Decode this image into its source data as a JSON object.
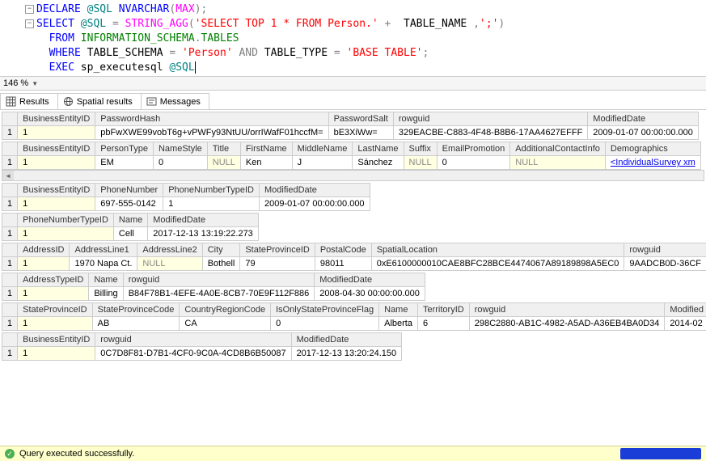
{
  "editor": {
    "lines": [
      {
        "collapse": true,
        "tokens": [
          {
            "cls": "kw-blue",
            "t": "DECLARE"
          },
          {
            "cls": "",
            "t": " "
          },
          {
            "cls": "kw-teal",
            "t": "@SQL"
          },
          {
            "cls": "",
            "t": " "
          },
          {
            "cls": "kw-blue",
            "t": "NVARCHAR"
          },
          {
            "cls": "kw-gray",
            "t": "("
          },
          {
            "cls": "kw-magenta",
            "t": "MAX"
          },
          {
            "cls": "kw-gray",
            "t": ");"
          }
        ]
      },
      {
        "collapse": true,
        "tokens": [
          {
            "cls": "kw-blue",
            "t": "SELECT"
          },
          {
            "cls": "",
            "t": " "
          },
          {
            "cls": "kw-teal",
            "t": "@SQL"
          },
          {
            "cls": "",
            "t": " "
          },
          {
            "cls": "kw-gray",
            "t": "="
          },
          {
            "cls": "",
            "t": " "
          },
          {
            "cls": "kw-magenta",
            "t": "STRING_AGG"
          },
          {
            "cls": "kw-gray",
            "t": "("
          },
          {
            "cls": "kw-red",
            "t": "'SELECT TOP 1 * FROM Person.'"
          },
          {
            "cls": "",
            "t": " "
          },
          {
            "cls": "kw-gray",
            "t": "+"
          },
          {
            "cls": "",
            "t": "  TABLE_NAME "
          },
          {
            "cls": "kw-gray",
            "t": ","
          },
          {
            "cls": "kw-red",
            "t": "';'"
          },
          {
            "cls": "kw-gray",
            "t": ")"
          }
        ]
      },
      {
        "collapse": false,
        "indent": "  ",
        "tokens": [
          {
            "cls": "kw-blue",
            "t": "FROM"
          },
          {
            "cls": "",
            "t": " "
          },
          {
            "cls": "kw-green",
            "t": "INFORMATION_SCHEMA"
          },
          {
            "cls": "kw-gray",
            "t": "."
          },
          {
            "cls": "kw-green",
            "t": "TABLES"
          }
        ]
      },
      {
        "collapse": false,
        "indent": "  ",
        "tokens": [
          {
            "cls": "kw-blue",
            "t": "WHERE"
          },
          {
            "cls": "",
            "t": " TABLE_SCHEMA "
          },
          {
            "cls": "kw-gray",
            "t": "="
          },
          {
            "cls": "",
            "t": " "
          },
          {
            "cls": "kw-red",
            "t": "'Person'"
          },
          {
            "cls": "",
            "t": " "
          },
          {
            "cls": "kw-gray",
            "t": "AND"
          },
          {
            "cls": "",
            "t": " TABLE_TYPE "
          },
          {
            "cls": "kw-gray",
            "t": "="
          },
          {
            "cls": "",
            "t": " "
          },
          {
            "cls": "kw-red",
            "t": "'BASE TABLE'"
          },
          {
            "cls": "kw-gray",
            "t": ";"
          }
        ]
      },
      {
        "collapse": false,
        "indent": "  ",
        "tokens": [
          {
            "cls": "kw-blue",
            "t": "EXEC"
          },
          {
            "cls": "",
            "t": " "
          },
          {
            "cls": "kw-black",
            "t": "sp_executesql "
          },
          {
            "cls": "kw-teal",
            "t": "@SQL"
          }
        ],
        "cursor": true
      }
    ]
  },
  "zoom": "146 %",
  "tabs": {
    "results": "Results",
    "spatial": "Spatial results",
    "messages": "Messages"
  },
  "grids": [
    {
      "headers": [
        "BusinessEntityID",
        "PasswordHash",
        "PasswordSalt",
        "rowguid",
        "ModifiedDate"
      ],
      "rows": [
        [
          "1",
          "pbFwXWE99vobT6g+vPWFy93NtUU/orrIWafF01hccfM=",
          "bE3XiWw=",
          "329EACBE-C883-4F48-B8B6-17AA4627EFFF",
          "2009-01-07 00:00:00.000"
        ]
      ]
    },
    {
      "headers": [
        "BusinessEntityID",
        "PersonType",
        "NameStyle",
        "Title",
        "FirstName",
        "MiddleName",
        "LastName",
        "Suffix",
        "EmailPromotion",
        "AdditionalContactInfo",
        "Demographics"
      ],
      "rows": [
        [
          "1",
          "EM",
          "0",
          "NULL",
          "Ken",
          "J",
          "Sánchez",
          "NULL",
          "0",
          "NULL",
          "<IndividualSurvey xm"
        ]
      ]
    },
    {
      "headers": [
        "BusinessEntityID",
        "PhoneNumber",
        "PhoneNumberTypeID",
        "ModifiedDate"
      ],
      "rows": [
        [
          "1",
          "697-555-0142",
          "1",
          "2009-01-07 00:00:00.000"
        ]
      ]
    },
    {
      "headers": [
        "PhoneNumberTypeID",
        "Name",
        "ModifiedDate"
      ],
      "rows": [
        [
          "1",
          "Cell",
          "2017-12-13 13:19:22.273"
        ]
      ]
    },
    {
      "headers": [
        "AddressID",
        "AddressLine1",
        "AddressLine2",
        "City",
        "StateProvinceID",
        "PostalCode",
        "SpatialLocation",
        "rowguid"
      ],
      "rows": [
        [
          "1",
          "1970 Napa Ct.",
          "NULL",
          "Bothell",
          "79",
          "98011",
          "0xE6100000010CAE8BFC28BCE4474067A89189898A5EC0",
          "9AADCB0D-36CF"
        ]
      ]
    },
    {
      "headers": [
        "AddressTypeID",
        "Name",
        "rowguid",
        "ModifiedDate"
      ],
      "rows": [
        [
          "1",
          "Billing",
          "B84F78B1-4EFE-4A0E-8CB7-70E9F112F886",
          "2008-04-30 00:00:00.000"
        ]
      ]
    },
    {
      "headers": [
        "StateProvinceID",
        "StateProvinceCode",
        "CountryRegionCode",
        "IsOnlyStateProvinceFlag",
        "Name",
        "TerritoryID",
        "rowguid",
        "Modified"
      ],
      "rows": [
        [
          "1",
          "AB",
          "CA",
          "0",
          "Alberta",
          "6",
          "298C2880-AB1C-4982-A5AD-A36EB4BA0D34",
          "2014-02"
        ]
      ]
    },
    {
      "headers": [
        "BusinessEntityID",
        "rowguid",
        "ModifiedDate"
      ],
      "rows": [
        [
          "1",
          "0C7D8F81-D7B1-4CF0-9C0A-4CD8B6B50087",
          "2017-12-13 13:20:24.150"
        ]
      ]
    }
  ],
  "status": "Query executed successfully."
}
